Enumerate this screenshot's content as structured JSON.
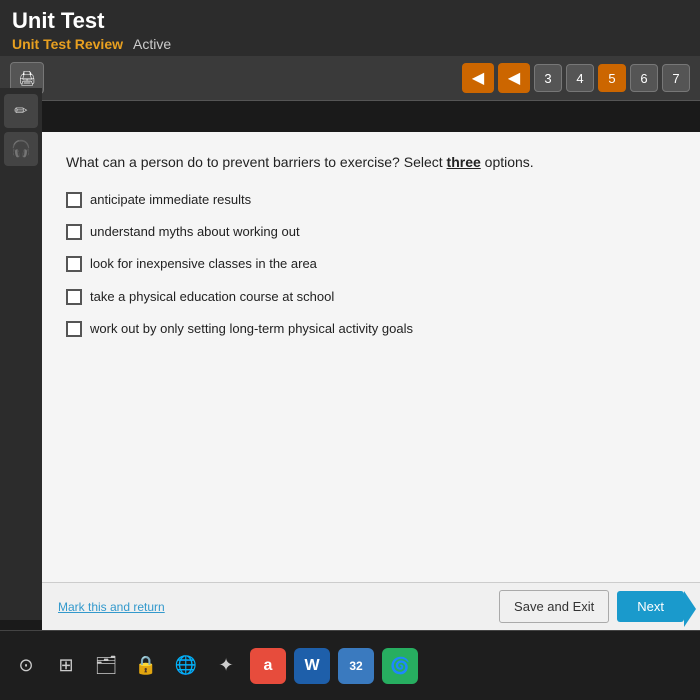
{
  "header": {
    "app_title": "Unit Test",
    "subtitle": "Unit Test Review",
    "status": "Active"
  },
  "toolbar": {
    "print_icon": "🖨",
    "back_arrow1": "◀",
    "back_arrow2": "◀",
    "pages": [
      {
        "num": "3",
        "active": false
      },
      {
        "num": "4",
        "active": false
      },
      {
        "num": "5",
        "active": true
      },
      {
        "num": "6",
        "active": false
      },
      {
        "num": "7",
        "active": false
      }
    ]
  },
  "sidebar": {
    "edit_icon": "✏",
    "audio_icon": "🎧"
  },
  "question": {
    "text_before_bold": "What can a person do to prevent barriers to exercise? Select ",
    "bold_word": "three",
    "text_after_bold": " options.",
    "options": [
      {
        "id": "opt1",
        "label": "anticipate immediate results",
        "checked": false
      },
      {
        "id": "opt2",
        "label": "understand myths about working out",
        "checked": false
      },
      {
        "id": "opt3",
        "label": "look for inexpensive classes in the area",
        "checked": false
      },
      {
        "id": "opt4",
        "label": "take a physical education course at school",
        "checked": false
      },
      {
        "id": "opt5",
        "label": "work out by only setting long-term physical activity goals",
        "checked": false
      }
    ]
  },
  "footer": {
    "mark_return": "Mark this and return",
    "save_exit": "Save and Exit",
    "next": "Next"
  },
  "taskbar": {
    "icons": [
      "⊙",
      "⊞",
      "🗂",
      "🔒",
      "🌐",
      "✦",
      "a",
      "W",
      "32",
      "🌀"
    ]
  }
}
